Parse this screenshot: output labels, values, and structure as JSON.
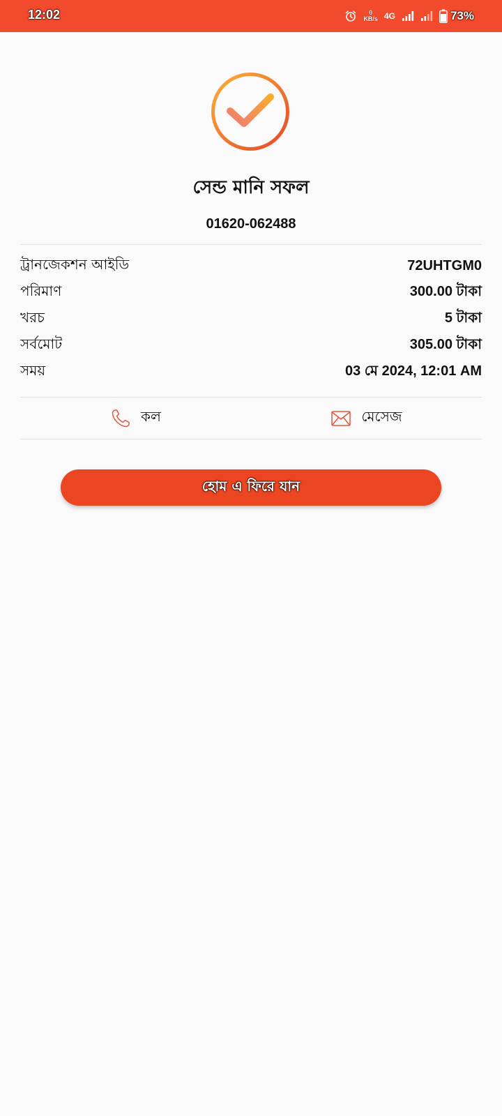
{
  "status_bar": {
    "time": "12:02",
    "data_rate_value": "0",
    "data_rate_unit": "KB/s",
    "network_type": "4G",
    "battery_percent": "73%",
    "icons": [
      "alarm-icon",
      "signal-icon",
      "signal-icon",
      "battery-icon"
    ]
  },
  "result": {
    "icon": "check-circle-icon",
    "title": "সেন্ড মানি সফল",
    "recipient_number": "01620-062488"
  },
  "details": [
    {
      "label": "ট্রানজেকশন আইডি",
      "value": "72UHTGM0"
    },
    {
      "label": "পরিমাণ",
      "value": "300.00 টাকা"
    },
    {
      "label": "খরচ",
      "value": "5 টাকা"
    },
    {
      "label": "সর্বমোট",
      "value": "305.00 টাকা"
    },
    {
      "label": "সময়",
      "value": "03 মে 2024, 12:01 AM"
    }
  ],
  "actions": {
    "call": {
      "label": "কল",
      "icon": "phone-icon"
    },
    "message": {
      "label": "মেসেজ",
      "icon": "envelope-icon"
    }
  },
  "home_button": {
    "label": "হোম এ ফিরে যান"
  },
  "colors": {
    "accent": "#f24a2c",
    "button": "#eb4521",
    "check_gradient_start": "#f9b13a",
    "check_gradient_end": "#e8462a"
  }
}
